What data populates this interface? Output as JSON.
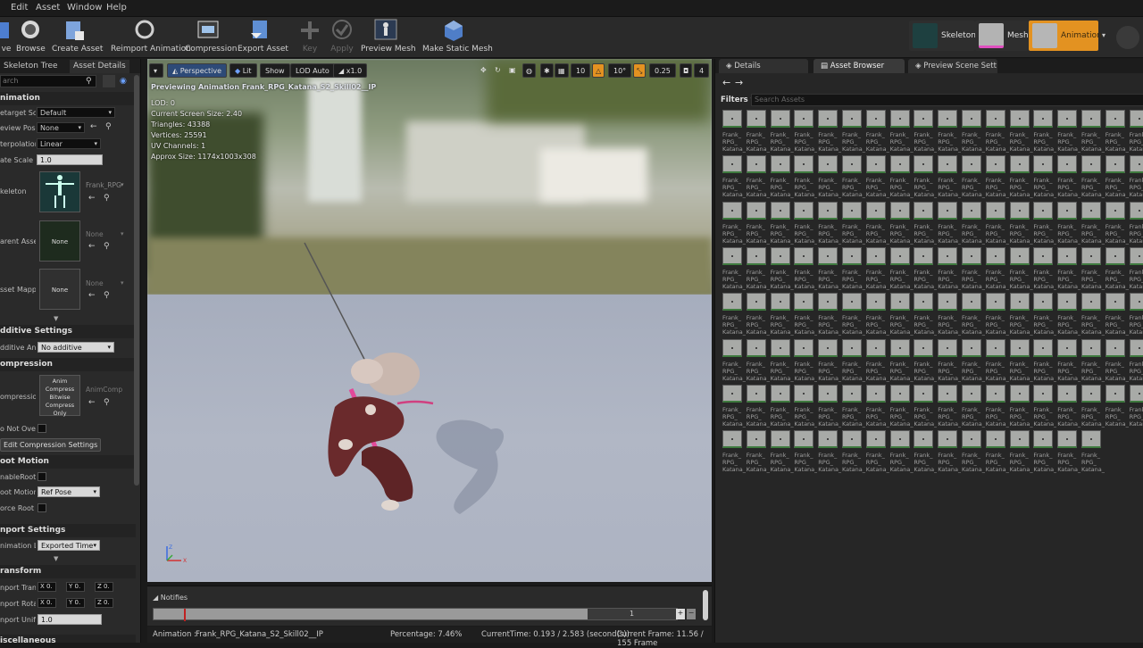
{
  "menu": [
    "Edit",
    "Asset",
    "Window",
    "Help"
  ],
  "toolbar": {
    "save": "ve",
    "browse": "Browse",
    "create_asset": "Create Asset",
    "reimport": "Reimport Animation",
    "compression": "Compression",
    "export": "Export Asset",
    "key": "Key",
    "apply": "Apply",
    "preview_mesh": "Preview Mesh",
    "make_static": "Make Static Mesh"
  },
  "modes": {
    "skeleton": "Skeleton",
    "mesh": "Mesh",
    "animation": "Animation"
  },
  "left": {
    "tabs": [
      "Skeleton Tree",
      "Asset Details"
    ],
    "search_placeholder": "arch",
    "sections": {
      "animation": "nimation",
      "additive": "dditive Settings",
      "compression": "ompression",
      "root": "oot Motion",
      "import": "nport Settings",
      "transform": "ransform",
      "misc": "iscellaneous"
    },
    "props": {
      "retarget_label": "etarget Sou",
      "retarget_value": "Default",
      "preview_pose_label": "eview Pose",
      "preview_pose_value": "None",
      "interp_label": "terpolation",
      "interp_value": "Linear",
      "rate_label": "ate Scale",
      "rate_value": "1.0",
      "skeleton_label": "keleton",
      "skeleton_asset": "Frank_RPG",
      "parent_label": "arent Asset",
      "parent_thumb": "None",
      "parent_value": "None",
      "mapping_label": "sset Mappin",
      "mapping_thumb": "None",
      "mapping_value": "None",
      "additive_label": "dditive Anim",
      "additive_value": "No additive",
      "compression_label": "ompression",
      "compression_thumb": "Anim Compress Bitwise Compress Only",
      "compression_value": "AnimComp",
      "no_override_label": "o Not Overr",
      "edit_compression": "Edit Compression Settings",
      "enable_root_label": "nableRootM",
      "root_lock_label": "oot Motion I",
      "root_lock_value": "Ref Pose",
      "force_root_label": "orce Root Lo",
      "anim_len_label": "nimation Le",
      "anim_len_value": "Exported Time",
      "import_trans_label": "nport Trans",
      "import_rot_label": "nport Rotat",
      "import_scale_label": "nport Unifor",
      "import_scale_value": "1.0",
      "trans_x": "X 0.",
      "trans_y": "Y 0.",
      "trans_z": "Z 0.",
      "rot_x": "X 0.",
      "rot_y": "Y 0.",
      "rot_z": "Z 0."
    }
  },
  "viewport": {
    "perspective": "Perspective",
    "lit": "Lit",
    "show": "Show",
    "lod": "LOD Auto",
    "speed": "x1.0",
    "grid": "10",
    "angle": "10°",
    "scale": "0.25",
    "cam": "4",
    "preview_text": "Previewing Animation Frank_RPG_Katana_S2_Skill02__IP",
    "stats": [
      "LOD: 0",
      "Current Screen Size: 2.40",
      "Triangles: 43388",
      "Vertices: 25591",
      "UV Channels: 1",
      "Approx Size: 1174x1003x308"
    ]
  },
  "timeline": {
    "notifies": "Notifies",
    "frame_input": "1"
  },
  "status": {
    "anim_label": "Animation :",
    "anim_name": "Frank_RPG_Katana_S2_Skill02__IP",
    "percentage": "Percentage:  7.46%",
    "current_time": "CurrentTime:  0.193 / 2.583 (second(s))",
    "current_frame": "Current Frame:  11.56 / 155 Frame"
  },
  "right": {
    "tabs": [
      "Details",
      "Asset Browser",
      "Preview Scene Sett"
    ],
    "filters": "Filters",
    "search_placeholder": "Search Assets",
    "asset_line1": "Frank_",
    "asset_line2": "RPG_",
    "asset_line3": "Katana_",
    "asset_line3_alt": "Katana_S"
  },
  "colors": {
    "accent_orange": "#e39221",
    "selected_blue": "#3a5a9c",
    "mesh_pink": "#e04fc0"
  }
}
